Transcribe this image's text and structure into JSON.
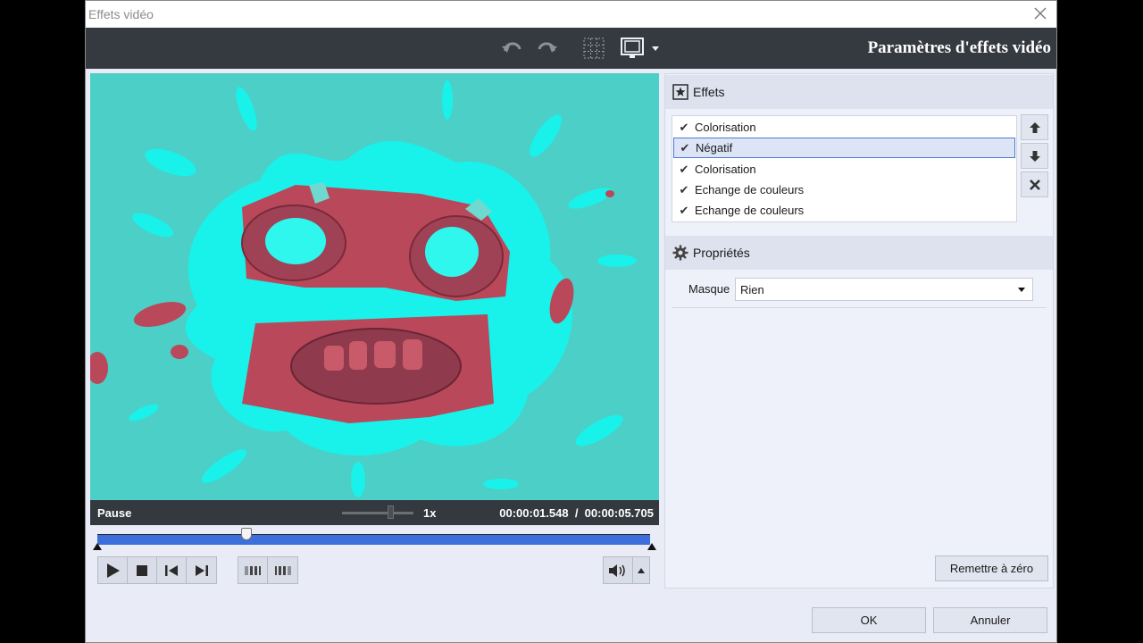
{
  "window": {
    "title": "Effets vidéo"
  },
  "toolbar": {
    "heading": "Paramètres d'effets vidéo"
  },
  "player": {
    "status": "Pause",
    "speed": "1x",
    "time": "00:00:01.548  /  00:00:05.705",
    "progress": 0.27
  },
  "effects": {
    "header": "Effets",
    "items": [
      {
        "label": "Colorisation",
        "checked": true,
        "selected": false
      },
      {
        "label": "Négatif",
        "checked": true,
        "selected": true
      },
      {
        "label": "Colorisation",
        "checked": true,
        "selected": false
      },
      {
        "label": "Echange de couleurs",
        "checked": true,
        "selected": false
      },
      {
        "label": "Echange de couleurs",
        "checked": true,
        "selected": false
      }
    ],
    "check_glyph": "✔"
  },
  "properties": {
    "header": "Propriétés",
    "mask_label": "Masque",
    "mask_value": "Rien"
  },
  "buttons": {
    "reset": "Remettre à zéro",
    "ok": "OK",
    "cancel": "Annuler"
  },
  "colors": {
    "toolbar_bg": "#353a40",
    "timeline": "#3c6edc",
    "preview_cyan": "#4bcfc7",
    "preview_red": "#b9485a"
  }
}
